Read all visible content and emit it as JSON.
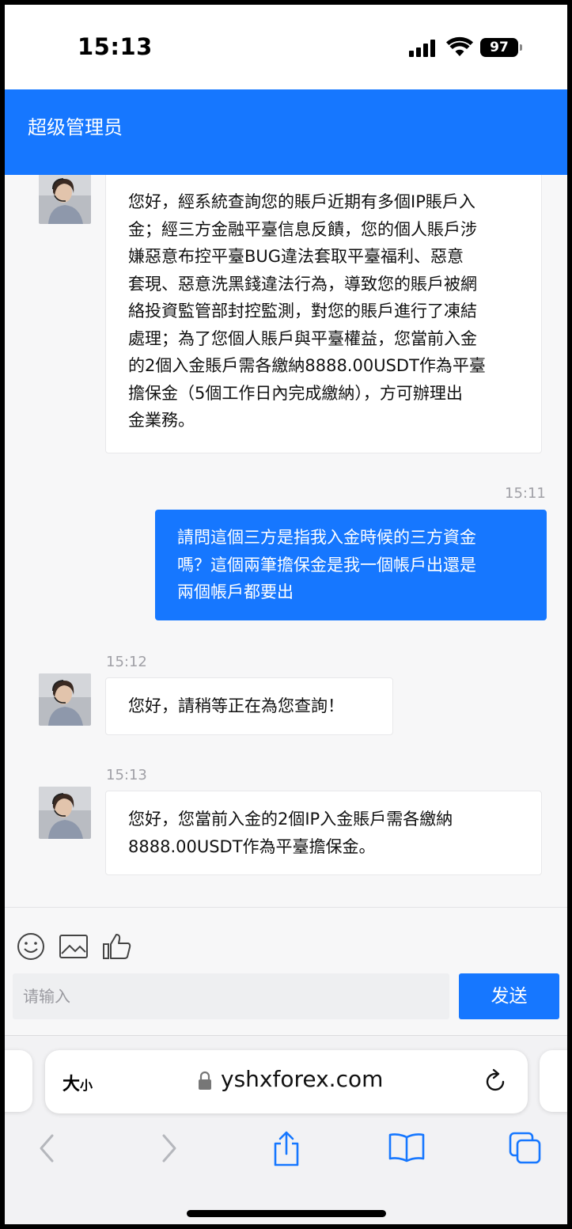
{
  "status_bar": {
    "time": "15:13",
    "battery": "97"
  },
  "header": {
    "title": "超级管理员"
  },
  "messages": [
    {
      "direction": "incoming",
      "time": "",
      "lines": [
        "您好，經系統查詢您的賬戶近期有多個IP賬戶入",
        "金；經三方金融平臺信息反饋，您的個人賬戶涉",
        "嫌惡意布控平臺BUG違法套取平臺福利、惡意",
        "套現、惡意洗黑錢違法行為，導致您的賬戶被網",
        "絡投資監管部封控監測，對您的賬戶進行了凍結",
        "處理；為了您個人賬戶與平臺權益，您當前入金",
        "的2個入金賬戶需各繳納8888.00USDT作為平臺",
        "擔保金（5個工作日內完成繳納），方可辦理出",
        "金業務。"
      ]
    },
    {
      "direction": "outgoing",
      "time": "15:11",
      "lines": [
        "請問這個三方是指我入金時候的三方資金",
        "嗎？這個兩筆擔保金是我一個帳戶出還是",
        "兩個帳戶都要出"
      ]
    },
    {
      "direction": "incoming",
      "time": "15:12",
      "lines": [
        "您好，請稍等正在為您查詢！"
      ]
    },
    {
      "direction": "incoming",
      "time": "15:13",
      "lines": [
        "您好，您當前入金的2個IP入金賬戶需各繳納",
        "8888.00USDT作為平臺擔保金。"
      ]
    }
  ],
  "composer": {
    "placeholder": "请输入",
    "send_label": "发送",
    "tools": [
      "emoji-icon",
      "image-icon",
      "thumbs-up-icon"
    ]
  },
  "browser": {
    "text_size_label": "大",
    "text_size_small": "小",
    "url": "yshxforex.com"
  },
  "colors": {
    "accent": "#1677ff",
    "background": "#f7f7f8"
  }
}
